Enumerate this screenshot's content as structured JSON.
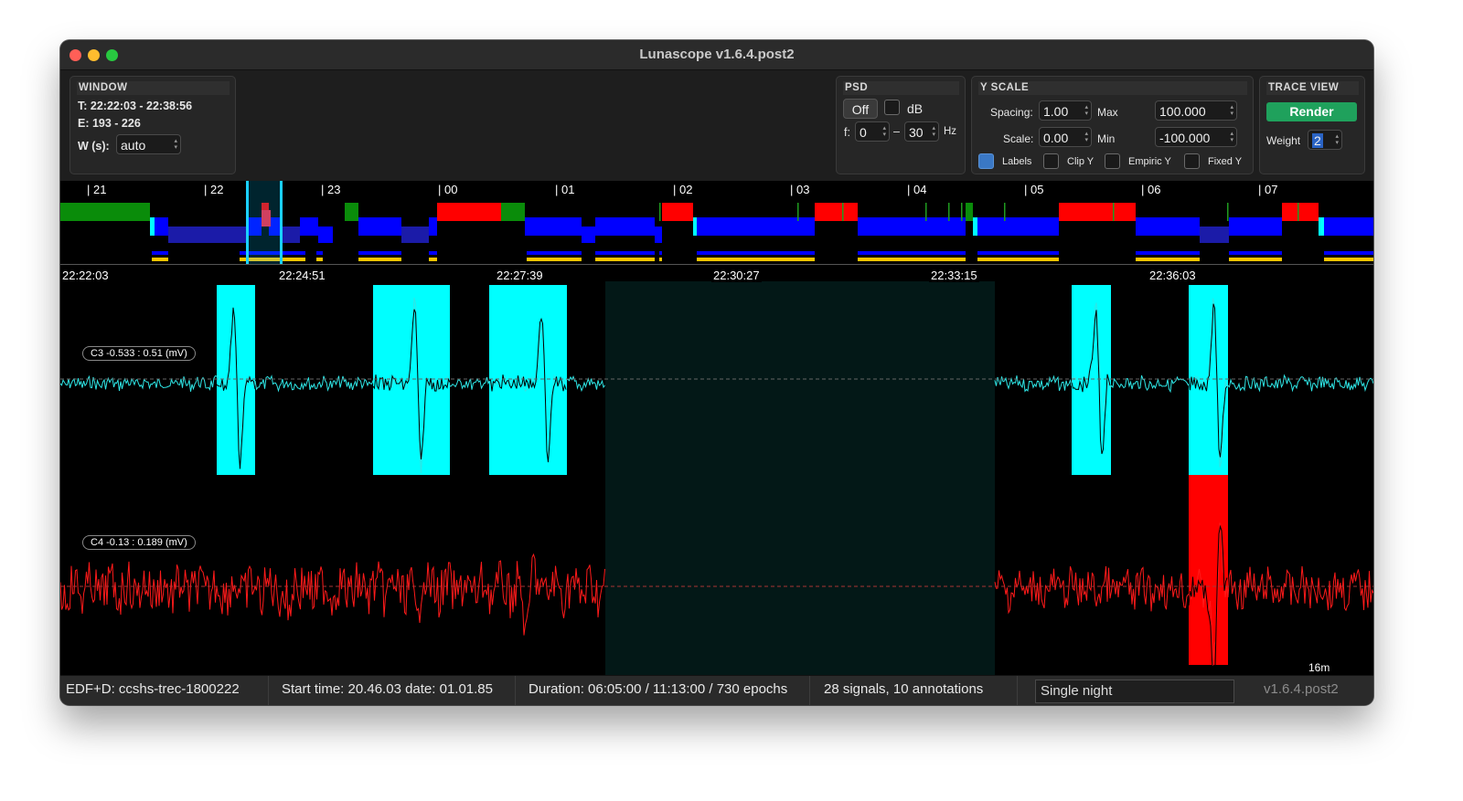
{
  "app": {
    "title": "Lunascope v1.6.4.post2"
  },
  "window_panel": {
    "title": "WINDOW",
    "time_range": "T: 22:22:03 - 22:38:56",
    "epoch_range": "E: 193 - 226",
    "width_label": "W (s):",
    "width_value": "auto"
  },
  "psd_panel": {
    "title": "PSD",
    "off_label": "Off",
    "db_label": "dB",
    "f_label": "f:",
    "f_min": "0",
    "dash": "–",
    "f_max": "30",
    "hz_label": "Hz"
  },
  "yscale_panel": {
    "title": "Y SCALE",
    "spacing_label": "Spacing:",
    "spacing_value": "1.00",
    "max_label": "Max",
    "max_value": "100.000",
    "scale_label": "Scale:",
    "scale_value": "0.00",
    "min_label": "Min",
    "min_value": "-100.000",
    "labels_label": "Labels",
    "clip_label": "Clip Y",
    "empiric_label": "Empiric Y",
    "fixed_label": "Fixed Y"
  },
  "trace_panel": {
    "title": "TRACE VIEW",
    "render_label": "Render",
    "weight_label": "Weight",
    "weight_value": "2"
  },
  "hypnogram": {
    "hour_labels": [
      "| 21",
      "| 22",
      "| 23",
      "| 00",
      "| 01",
      "| 02",
      "| 03",
      "| 04",
      "| 05",
      "| 06",
      "| 07"
    ]
  },
  "signal_view": {
    "time_ticks": [
      "22:22:03",
      "22:24:51",
      "22:27:39",
      "22:30:27",
      "22:33:15",
      "22:36:03"
    ],
    "channels": [
      {
        "label": "C3 -0.533 : 0.51 (mV)",
        "color": "#2ee6e6"
      },
      {
        "label": "C4 -0.13 : 0.189 (mV)",
        "color": "#ff1a1a"
      }
    ],
    "scale_label": "16m"
  },
  "colors": {
    "cyan": "#00ffff",
    "red": "#ff0000",
    "blue": "#0000ff",
    "green": "#0a8c0a",
    "yellow": "#ffc400",
    "gap": "#031817",
    "render": "#1fa15c"
  },
  "status": {
    "file": "EDF+D: ccshs-trec-1800222",
    "start": "Start time: 20.46.03 date: 01.01.85",
    "duration": "Duration: 06:05:00 / 11:13:00 / 730 epochs",
    "counts": "28 signals, 10 annotations",
    "mode": "Single night",
    "version": "v1.6.4.post2"
  }
}
